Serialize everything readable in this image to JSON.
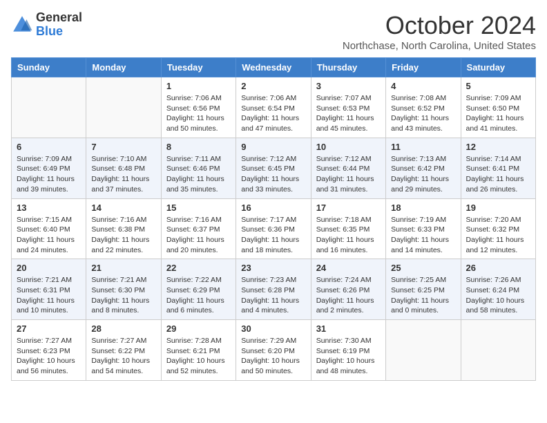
{
  "header": {
    "logo_general": "General",
    "logo_blue": "Blue",
    "title": "October 2024",
    "location": "Northchase, North Carolina, United States"
  },
  "days_of_week": [
    "Sunday",
    "Monday",
    "Tuesday",
    "Wednesday",
    "Thursday",
    "Friday",
    "Saturday"
  ],
  "weeks": [
    [
      {
        "day": "",
        "info": ""
      },
      {
        "day": "",
        "info": ""
      },
      {
        "day": "1",
        "info": "Sunrise: 7:06 AM\nSunset: 6:56 PM\nDaylight: 11 hours and 50 minutes."
      },
      {
        "day": "2",
        "info": "Sunrise: 7:06 AM\nSunset: 6:54 PM\nDaylight: 11 hours and 47 minutes."
      },
      {
        "day": "3",
        "info": "Sunrise: 7:07 AM\nSunset: 6:53 PM\nDaylight: 11 hours and 45 minutes."
      },
      {
        "day": "4",
        "info": "Sunrise: 7:08 AM\nSunset: 6:52 PM\nDaylight: 11 hours and 43 minutes."
      },
      {
        "day": "5",
        "info": "Sunrise: 7:09 AM\nSunset: 6:50 PM\nDaylight: 11 hours and 41 minutes."
      }
    ],
    [
      {
        "day": "6",
        "info": "Sunrise: 7:09 AM\nSunset: 6:49 PM\nDaylight: 11 hours and 39 minutes."
      },
      {
        "day": "7",
        "info": "Sunrise: 7:10 AM\nSunset: 6:48 PM\nDaylight: 11 hours and 37 minutes."
      },
      {
        "day": "8",
        "info": "Sunrise: 7:11 AM\nSunset: 6:46 PM\nDaylight: 11 hours and 35 minutes."
      },
      {
        "day": "9",
        "info": "Sunrise: 7:12 AM\nSunset: 6:45 PM\nDaylight: 11 hours and 33 minutes."
      },
      {
        "day": "10",
        "info": "Sunrise: 7:12 AM\nSunset: 6:44 PM\nDaylight: 11 hours and 31 minutes."
      },
      {
        "day": "11",
        "info": "Sunrise: 7:13 AM\nSunset: 6:42 PM\nDaylight: 11 hours and 29 minutes."
      },
      {
        "day": "12",
        "info": "Sunrise: 7:14 AM\nSunset: 6:41 PM\nDaylight: 11 hours and 26 minutes."
      }
    ],
    [
      {
        "day": "13",
        "info": "Sunrise: 7:15 AM\nSunset: 6:40 PM\nDaylight: 11 hours and 24 minutes."
      },
      {
        "day": "14",
        "info": "Sunrise: 7:16 AM\nSunset: 6:38 PM\nDaylight: 11 hours and 22 minutes."
      },
      {
        "day": "15",
        "info": "Sunrise: 7:16 AM\nSunset: 6:37 PM\nDaylight: 11 hours and 20 minutes."
      },
      {
        "day": "16",
        "info": "Sunrise: 7:17 AM\nSunset: 6:36 PM\nDaylight: 11 hours and 18 minutes."
      },
      {
        "day": "17",
        "info": "Sunrise: 7:18 AM\nSunset: 6:35 PM\nDaylight: 11 hours and 16 minutes."
      },
      {
        "day": "18",
        "info": "Sunrise: 7:19 AM\nSunset: 6:33 PM\nDaylight: 11 hours and 14 minutes."
      },
      {
        "day": "19",
        "info": "Sunrise: 7:20 AM\nSunset: 6:32 PM\nDaylight: 11 hours and 12 minutes."
      }
    ],
    [
      {
        "day": "20",
        "info": "Sunrise: 7:21 AM\nSunset: 6:31 PM\nDaylight: 11 hours and 10 minutes."
      },
      {
        "day": "21",
        "info": "Sunrise: 7:21 AM\nSunset: 6:30 PM\nDaylight: 11 hours and 8 minutes."
      },
      {
        "day": "22",
        "info": "Sunrise: 7:22 AM\nSunset: 6:29 PM\nDaylight: 11 hours and 6 minutes."
      },
      {
        "day": "23",
        "info": "Sunrise: 7:23 AM\nSunset: 6:28 PM\nDaylight: 11 hours and 4 minutes."
      },
      {
        "day": "24",
        "info": "Sunrise: 7:24 AM\nSunset: 6:26 PM\nDaylight: 11 hours and 2 minutes."
      },
      {
        "day": "25",
        "info": "Sunrise: 7:25 AM\nSunset: 6:25 PM\nDaylight: 11 hours and 0 minutes."
      },
      {
        "day": "26",
        "info": "Sunrise: 7:26 AM\nSunset: 6:24 PM\nDaylight: 10 hours and 58 minutes."
      }
    ],
    [
      {
        "day": "27",
        "info": "Sunrise: 7:27 AM\nSunset: 6:23 PM\nDaylight: 10 hours and 56 minutes."
      },
      {
        "day": "28",
        "info": "Sunrise: 7:27 AM\nSunset: 6:22 PM\nDaylight: 10 hours and 54 minutes."
      },
      {
        "day": "29",
        "info": "Sunrise: 7:28 AM\nSunset: 6:21 PM\nDaylight: 10 hours and 52 minutes."
      },
      {
        "day": "30",
        "info": "Sunrise: 7:29 AM\nSunset: 6:20 PM\nDaylight: 10 hours and 50 minutes."
      },
      {
        "day": "31",
        "info": "Sunrise: 7:30 AM\nSunset: 6:19 PM\nDaylight: 10 hours and 48 minutes."
      },
      {
        "day": "",
        "info": ""
      },
      {
        "day": "",
        "info": ""
      }
    ]
  ]
}
